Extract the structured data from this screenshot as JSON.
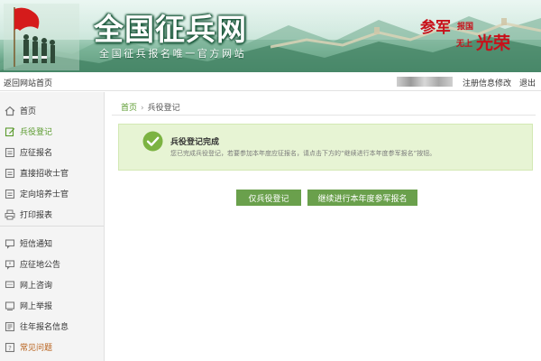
{
  "banner": {
    "title": "全国征兵网",
    "subtitle": "全国征兵报名唯一官方网站",
    "slogan": {
      "s1": "参军",
      "s2": "报国",
      "s3": "无上",
      "s4": "光荣"
    }
  },
  "topbar": {
    "back_label": "返回网站首页",
    "edit_label": "注册信息修改",
    "logout_label": "退出"
  },
  "sidebar": {
    "items": [
      {
        "label": "首页",
        "icon": "home-icon"
      },
      {
        "label": "兵役登记",
        "icon": "edit-icon",
        "state": "active"
      },
      {
        "label": "应征报名",
        "icon": "form-icon"
      },
      {
        "label": "直接招收士官",
        "icon": "form-icon"
      },
      {
        "label": "定向培养士官",
        "icon": "form-icon"
      },
      {
        "label": "打印报表",
        "icon": "printer-icon"
      },
      {
        "label": "短信通知",
        "icon": "message-icon"
      },
      {
        "label": "应征地公告",
        "icon": "notice-icon"
      },
      {
        "label": "网上咨询",
        "icon": "chat-icon"
      },
      {
        "label": "网上举报",
        "icon": "report-icon"
      },
      {
        "label": "往年报名信息",
        "icon": "history-icon"
      },
      {
        "label": "常见问题",
        "icon": "question-icon",
        "state": "highlight"
      }
    ]
  },
  "breadcrumb": {
    "home": "首页",
    "separator": "›",
    "current": "兵役登记"
  },
  "notice": {
    "title": "兵役登记完成",
    "message": "您已完成兵役登记，若要参加本年度应征报名，请点击下方的“继续进行本年度参军报名”按钮。"
  },
  "buttons": {
    "register_only": "仅兵役登记",
    "continue_enlist": "继续进行本年度参军报名"
  },
  "colors": {
    "accent_green": "#6aa04c",
    "notice_bg": "#e7f4d4",
    "slogan_red": "#c8101a",
    "highlight_orange": "#b8601a"
  }
}
